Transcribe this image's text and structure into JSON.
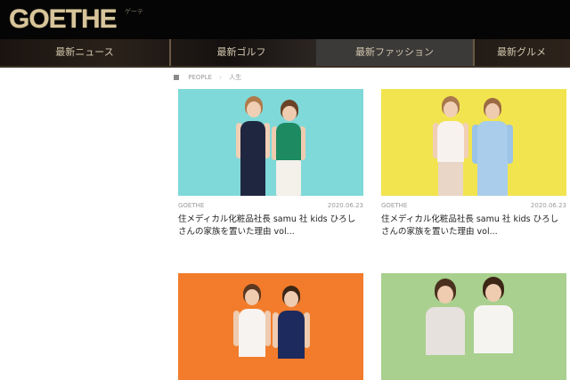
{
  "header": {
    "logo": "GOETHE",
    "logo_sub": "ゲーテ"
  },
  "nav": {
    "items": [
      {
        "label": "最新ニュース"
      },
      {
        "label": "最新ゴルフ"
      },
      {
        "label": "最新ファッション"
      },
      {
        "label": "最新グルメ"
      }
    ]
  },
  "breadcrumb": {
    "items": [
      "PEOPLE",
      "人生"
    ]
  },
  "cards": [
    {
      "category": "GOETHE",
      "date": "2020.06.23",
      "title": "住メディカル化粧品社長 samu 社 kids ひろしさんの家族を置いた理由 vol...",
      "thumb_bg": "#7fd9d8"
    },
    {
      "category": "GOETHE",
      "date": "2020.06.23",
      "title": "住メディカル化粧品社長 samu 社 kids ひろしさんの家族を置いた理由 vol...",
      "thumb_bg": "#f2e44f"
    },
    {
      "category": "",
      "date": "",
      "title": "",
      "thumb_bg": "#f27c2b"
    },
    {
      "category": "",
      "date": "",
      "title": "",
      "thumb_bg": "#a9d08e"
    }
  ]
}
